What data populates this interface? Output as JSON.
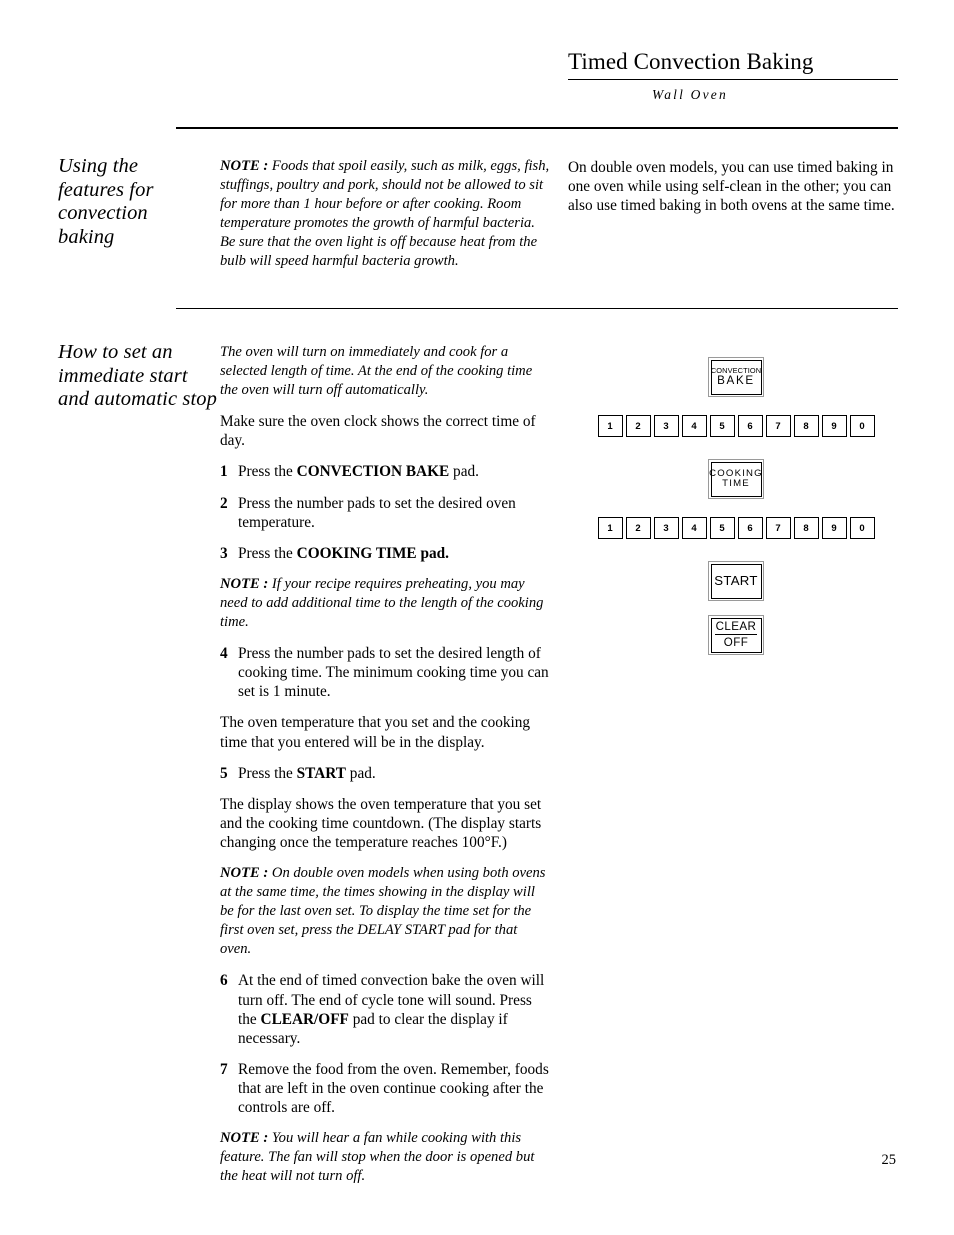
{
  "header": {
    "title": "Timed Convection Baking",
    "subtitle": "Wall Oven"
  },
  "sections": {
    "using_features": {
      "heading": "Using the features for convection baking",
      "note_label": "NOTE :",
      "note_text": " Foods that spoil easily, such as milk, eggs, fish, stuffings, poultry and pork, should not be allowed to sit for more than 1 hour before or after cooking. Room temperature promotes the growth of harmful bacteria. Be sure that the oven light is off because heat from the bulb will speed harmful bacteria growth.",
      "right_text": "On double oven models, you can use timed baking in one oven while using self-clean in the other; you can also use timed baking in both ovens at the same time."
    },
    "immediate_start": {
      "heading": "How to set an immediate start and automatic stop",
      "intro_italic": "The oven will turn on immediately and cook for a selected length of time. At the end of the cooking time the oven will turn off automatically.",
      "clock_text": "Make sure the oven clock shows the correct time of day.",
      "steps": [
        {
          "num": "1",
          "pre": "Press the ",
          "bold": "CONVECTION BAKE",
          "post": " pad."
        },
        {
          "num": "2",
          "pre": "Press the number pads to set the desired oven temperature.",
          "bold": "",
          "post": ""
        },
        {
          "num": "3",
          "pre": "Press the ",
          "bold": "COOKING TIME pad.",
          "post": ""
        }
      ],
      "note_preheat_label": "NOTE :",
      "note_preheat_text": " If your recipe requires preheating, you may need to add additional time to the length of the cooking time.",
      "step4": {
        "num": "4",
        "text": "Press the number pads to set the desired length of cooking time. The minimum cooking time you can set is 1 minute."
      },
      "temp_display_text": "The oven temperature that you set and the cooking time that you entered will be in the display.",
      "step5": {
        "num": "5",
        "pre": "Press the ",
        "bold": "START",
        "post": " pad."
      },
      "display_text": "The display shows the oven temperature that you set and the cooking time countdown. (The display starts changing once the temperature reaches 100°F.)",
      "note_double_label": "NOTE :",
      "note_double_text": " On double oven models when using both ovens at the same time, the times showing in the display will be for the last oven set. To display the time set for the first oven set, press the DELAY START pad for that oven.",
      "step6": {
        "num": "6",
        "pre": "At the end of timed convection bake the oven will turn off. The end of cycle tone will sound. Press the ",
        "bold": "CLEAR/OFF",
        "post": " pad to clear the display if necessary."
      },
      "step7": {
        "num": "7",
        "text": "Remove the food from the oven. Remember, foods that are left in the oven continue cooking after the controls are off."
      },
      "note_fan_label": "NOTE :",
      "note_fan_text": " You will hear a fan while cooking with this feature. The fan will stop when the door is opened but the heat will not turn off."
    }
  },
  "control_panel": {
    "convection_bake": {
      "line1": "CONVECTION",
      "line2": "BAKE"
    },
    "cooking_time": {
      "line1": "COOKING",
      "line2": "TIME"
    },
    "start": {
      "label": "START"
    },
    "clear_off": {
      "line1": "CLEAR",
      "line2": "OFF"
    },
    "number_pads": [
      "1",
      "2",
      "3",
      "4",
      "5",
      "6",
      "7",
      "8",
      "9",
      "0"
    ]
  },
  "footer": {
    "page_number": "25"
  }
}
